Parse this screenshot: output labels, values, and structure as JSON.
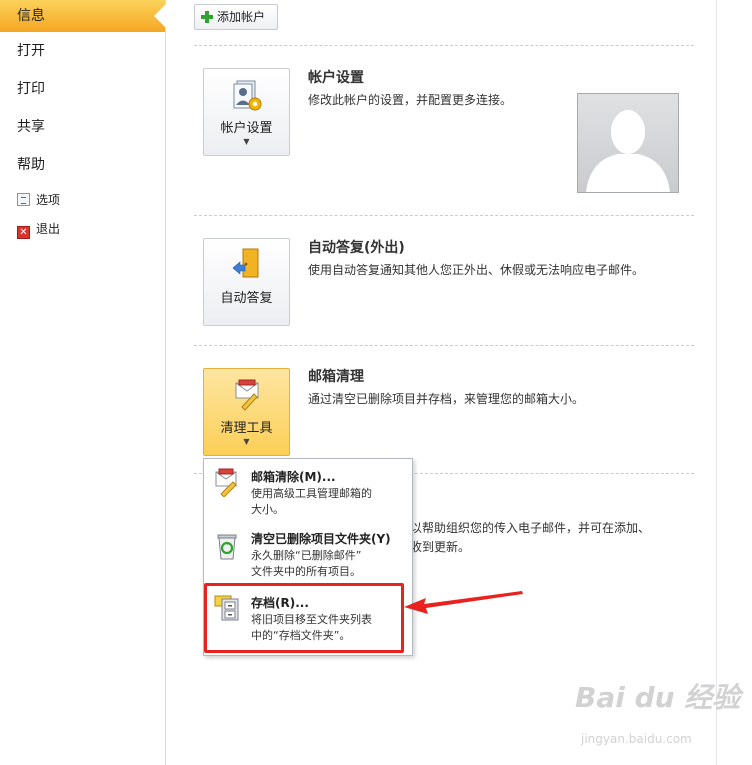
{
  "nav": {
    "items": [
      "信息",
      "打开",
      "打印",
      "共享",
      "帮助"
    ],
    "sub": [
      "选项",
      "退出"
    ]
  },
  "toolbar": {
    "add_account": "添加帐户"
  },
  "sections": {
    "account": {
      "button": "帐户设置",
      "title": "帐户设置",
      "desc": "修改此帐户的设置，并配置更多连接。"
    },
    "auto_reply": {
      "button": "自动答复",
      "title": "自动答复(外出)",
      "desc": "使用自动答复通知其他人您正外出、休假或无法响应电子邮件。"
    },
    "cleanup": {
      "button": "清理工具",
      "title": "邮箱清理",
      "desc": "通过清空已删除项目并存档，来管理您的邮箱大小。"
    },
    "rules_partial": {
      "line1": "以帮助组织您的传入电子邮件，并可在添加、",
      "line2": "收到更新。"
    }
  },
  "menu": {
    "items": [
      {
        "title": "邮箱清除(M)...",
        "desc": [
          "使用高级工具管理邮箱的",
          "大小。"
        ]
      },
      {
        "title": "清空已删除项目文件夹(Y)",
        "desc": [
          "永久删除“已删除邮件”",
          "文件夹中的所有项目。"
        ]
      },
      {
        "title": "存档(R)...",
        "desc": [
          "将旧项目移至文件夹列表",
          "中的“存档文件夹”。"
        ]
      }
    ]
  },
  "watermark": {
    "brand": "Bai du 经验",
    "url": "jingyan.baidu.com"
  },
  "colors": {
    "accent": "#f5a623",
    "highlight": "#e8231f",
    "arrow": "#e8231f"
  }
}
